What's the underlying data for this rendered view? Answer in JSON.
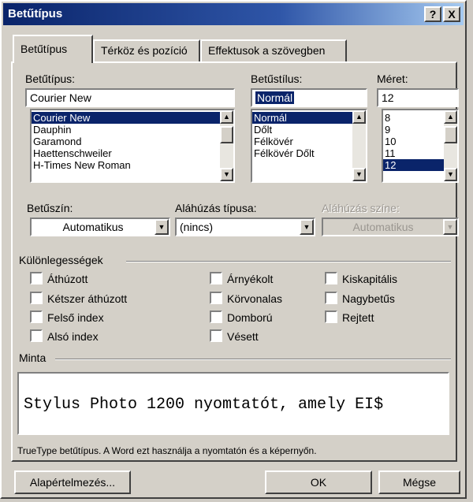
{
  "window": {
    "title": "Betűtípus"
  },
  "titlebar": {
    "help_label": "?",
    "close_label": "X"
  },
  "tabs": [
    {
      "label": "Betűtípus"
    },
    {
      "label": "Térköz és pozíció"
    },
    {
      "label": "Effektusok a szövegben"
    }
  ],
  "font": {
    "label": "Betűtípus:",
    "value": "Courier New",
    "items": [
      "Courier New",
      "Dauphin",
      "Garamond",
      "Haettenschweiler",
      "H-Times New Roman"
    ],
    "selected": "Courier New"
  },
  "style": {
    "label": "Betűstílus:",
    "value": "Normál",
    "items": [
      "Normál",
      "Dőlt",
      "Félkövér",
      "Félkövér Dőlt"
    ],
    "selected": "Normál"
  },
  "size": {
    "label": "Méret:",
    "value": "12",
    "items": [
      "8",
      "9",
      "10",
      "11",
      "12"
    ],
    "selected": "12"
  },
  "font_color": {
    "label": "Betűszín:",
    "value": "Automatikus"
  },
  "underline_type": {
    "label": "Aláhúzás típusa:",
    "value": "(nincs)"
  },
  "underline_color": {
    "label": "Aláhúzás színe:",
    "value": "Automatikus"
  },
  "effects": {
    "label": "Különlegességek",
    "col1": [
      "Áthúzott",
      "Kétszer áthúzott",
      "Felső index",
      "Alsó index"
    ],
    "col2": [
      "Árnyékolt",
      "Körvonalas",
      "Domború",
      "Vésett"
    ],
    "col3": [
      "Kiskapitális",
      "Nagybetűs",
      "Rejtett"
    ]
  },
  "preview": {
    "label": "Minta",
    "text": "Stylus Photo 1200 nyomtatót, amely EI$"
  },
  "info_text": "TrueType betűtípus. A Word ezt használja a nyomtatón és a képernyőn.",
  "buttons": {
    "default": "Alapértelmezés...",
    "ok": "OK",
    "cancel": "Mégse"
  },
  "colors": {
    "title_start": "#0a246a",
    "selection": "#0a246a",
    "face": "#d4d0c8"
  }
}
